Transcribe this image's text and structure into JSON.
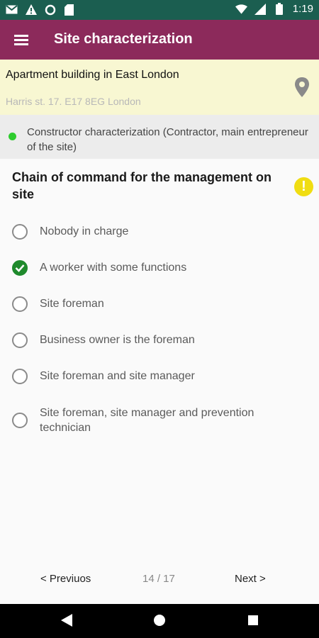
{
  "status_bar": {
    "time": "1:19"
  },
  "appbar": {
    "title": "Site characterization"
  },
  "location": {
    "name": "Apartment building in East London",
    "address": "Harris st. 17. E17 8EG London"
  },
  "section": {
    "label": "Constructor characterization (Contractor, main entrepreneur of the site)",
    "status_color": "#2ecc2e"
  },
  "question": {
    "text": "Chain of command for the management on site",
    "warning_icon": "!"
  },
  "options": [
    {
      "label": "Nobody in charge",
      "selected": false
    },
    {
      "label": "A worker with some functions",
      "selected": true
    },
    {
      "label": "Site foreman",
      "selected": false
    },
    {
      "label": "Business owner is the foreman",
      "selected": false
    },
    {
      "label": "Site foreman and site manager",
      "selected": false
    },
    {
      "label": "Site foreman, site manager and prevention technician",
      "selected": false
    }
  ],
  "footer": {
    "previous_label": "< Previuos",
    "pager": "14 / 17",
    "next_label": "Next >"
  },
  "colors": {
    "status_bar": "#1b5e50",
    "app_bar": "#8c2a5b",
    "location_bg": "#f8f7d2",
    "checked": "#1f8a2c",
    "warning": "#f0dd12"
  }
}
